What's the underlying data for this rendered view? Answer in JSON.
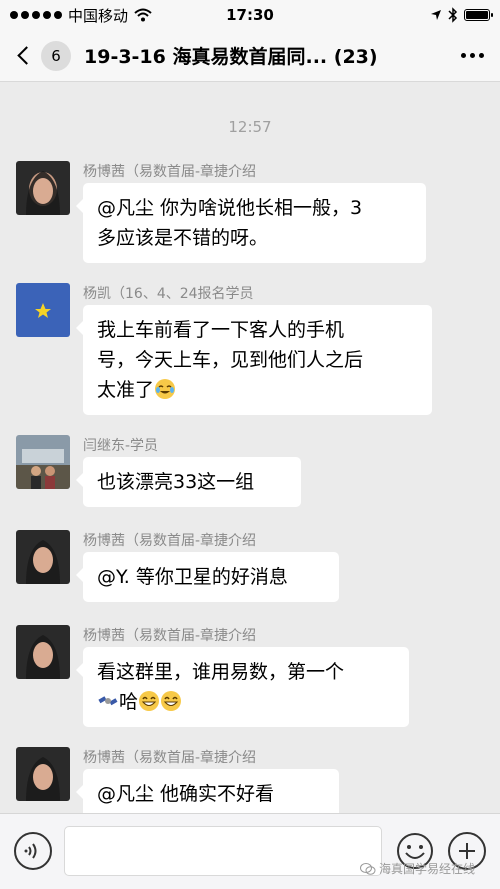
{
  "status_bar": {
    "carrier": "中国移动",
    "time": "17:30"
  },
  "nav": {
    "back_count": "6",
    "title": "19-3-16 海真易数首届同... (23)"
  },
  "chat": {
    "timestamp": "12:57",
    "messages": [
      {
        "sender": "杨博茜（易数首届-章捷介绍",
        "lines": [
          "@凡尘 你为啥说他长相一般，3",
          "多应该是不错的呀。"
        ]
      },
      {
        "sender": "杨凯（16、4、24报名学员",
        "lines": [
          "我上车前看了一下客人的手机",
          "号，今天上车，见到他们人之后",
          "太准了"
        ]
      },
      {
        "sender": "闫继东-学员",
        "lines": [
          "也该漂亮33这一组"
        ]
      },
      {
        "sender": "杨博茜（易数首届-章捷介绍",
        "lines": [
          "@Y. 等你卫星的好消息"
        ]
      },
      {
        "sender": "杨博茜（易数首届-章捷介绍",
        "lines": [
          "看这群里，谁用易数，第一个",
          "哈"
        ]
      },
      {
        "sender": "杨博茜（易数首届-章捷介绍",
        "lines": [
          "@凡尘 他确实不好看"
        ]
      }
    ]
  },
  "input_bar": {
    "text_value": ""
  },
  "watermark": "海真国学易经在线",
  "icons": {
    "wifi": "wifi-icon",
    "location": "location-icon",
    "bluetooth": "bluetooth-icon",
    "battery": "battery-icon",
    "voice": "voice-icon",
    "emoji": "emoji-icon",
    "plus": "plus-icon"
  }
}
